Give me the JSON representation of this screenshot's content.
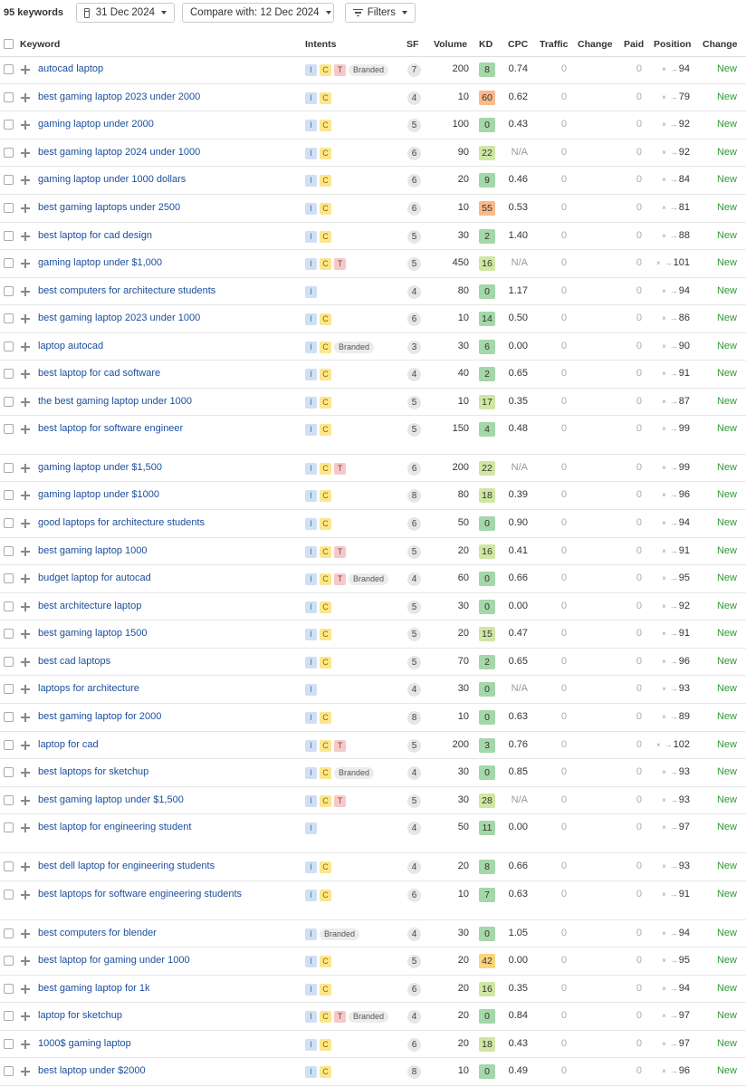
{
  "toolbar": {
    "keyword_count": "95 keywords",
    "date_label": "31 Dec 2024",
    "compare_label": "Compare with: 12 Dec 2024",
    "filters_label": "Filters"
  },
  "columns": {
    "keyword": "Keyword",
    "intents": "Intents",
    "sf": "SF",
    "volume": "Volume",
    "kd": "KD",
    "cpc": "CPC",
    "traffic": "Traffic",
    "change": "Change",
    "paid": "Paid",
    "position": "Position",
    "position_change": "Change"
  },
  "kd_colors": {
    "very_easy": "#a4d7a9",
    "easy": "#cfe7a3",
    "medium": "#fbd57a",
    "hard": "#f9b98a"
  },
  "rows": [
    {
      "keyword": "autocad laptop",
      "intents": [
        "I",
        "C",
        "T",
        "Branded"
      ],
      "sf": "7",
      "volume": "200",
      "kd": "8",
      "cpc": "0.74",
      "traffic": "0",
      "paid": "0",
      "pos_prev": "×",
      "position": "94",
      "change": "New"
    },
    {
      "keyword": "best gaming laptop 2023 under 2000",
      "intents": [
        "I",
        "C"
      ],
      "sf": "4",
      "volume": "10",
      "kd": "60",
      "cpc": "0.62",
      "traffic": "0",
      "paid": "0",
      "pos_prev": "×",
      "position": "79",
      "change": "New"
    },
    {
      "keyword": "gaming laptop under 2000",
      "intents": [
        "I",
        "C"
      ],
      "sf": "5",
      "volume": "100",
      "kd": "0",
      "cpc": "0.43",
      "traffic": "0",
      "paid": "0",
      "pos_prev": "×",
      "position": "92",
      "change": "New"
    },
    {
      "keyword": "best gaming laptop 2024 under 1000",
      "intents": [
        "I",
        "C"
      ],
      "sf": "6",
      "volume": "90",
      "kd": "22",
      "cpc": "N/A",
      "traffic": "0",
      "paid": "0",
      "pos_prev": "×",
      "position": "92",
      "change": "New"
    },
    {
      "keyword": "gaming laptop under 1000 dollars",
      "intents": [
        "I",
        "C"
      ],
      "sf": "6",
      "volume": "20",
      "kd": "9",
      "cpc": "0.46",
      "traffic": "0",
      "paid": "0",
      "pos_prev": "×",
      "position": "84",
      "change": "New"
    },
    {
      "keyword": "best gaming laptops under 2500",
      "intents": [
        "I",
        "C"
      ],
      "sf": "6",
      "volume": "10",
      "kd": "55",
      "cpc": "0.53",
      "traffic": "0",
      "paid": "0",
      "pos_prev": "×",
      "position": "81",
      "change": "New"
    },
    {
      "keyword": "best laptop for cad design",
      "intents": [
        "I",
        "C"
      ],
      "sf": "5",
      "volume": "30",
      "kd": "2",
      "cpc": "1.40",
      "traffic": "0",
      "paid": "0",
      "pos_prev": "×",
      "position": "88",
      "change": "New"
    },
    {
      "keyword": "gaming laptop under $1,000",
      "intents": [
        "I",
        "C",
        "T"
      ],
      "sf": "5",
      "volume": "450",
      "kd": "16",
      "cpc": "N/A",
      "traffic": "0",
      "paid": "0",
      "pos_prev": "×",
      "position": "101",
      "change": "New"
    },
    {
      "keyword": "best computers for architecture students",
      "intents": [
        "I"
      ],
      "sf": "4",
      "volume": "80",
      "kd": "0",
      "cpc": "1.17",
      "traffic": "0",
      "paid": "0",
      "pos_prev": "×",
      "position": "94",
      "change": "New"
    },
    {
      "keyword": "best gaming laptop 2023 under 1000",
      "intents": [
        "I",
        "C"
      ],
      "sf": "6",
      "volume": "10",
      "kd": "14",
      "cpc": "0.50",
      "traffic": "0",
      "paid": "0",
      "pos_prev": "×",
      "position": "86",
      "change": "New"
    },
    {
      "keyword": "laptop autocad",
      "intents": [
        "I",
        "C",
        "Branded"
      ],
      "sf": "3",
      "volume": "30",
      "kd": "6",
      "cpc": "0.00",
      "traffic": "0",
      "paid": "0",
      "pos_prev": "×",
      "position": "90",
      "change": "New"
    },
    {
      "keyword": "best laptop for cad software",
      "intents": [
        "I",
        "C"
      ],
      "sf": "4",
      "volume": "40",
      "kd": "2",
      "cpc": "0.65",
      "traffic": "0",
      "paid": "0",
      "pos_prev": "×",
      "position": "91",
      "change": "New"
    },
    {
      "keyword": "the best gaming laptop under 1000",
      "intents": [
        "I",
        "C"
      ],
      "sf": "5",
      "volume": "10",
      "kd": "17",
      "cpc": "0.35",
      "traffic": "0",
      "paid": "0",
      "pos_prev": "×",
      "position": "87",
      "change": "New"
    },
    {
      "keyword": "best laptop for software engineer",
      "intents": [
        "I",
        "C"
      ],
      "sf": "5",
      "volume": "150",
      "kd": "4",
      "cpc": "0.48",
      "traffic": "0",
      "paid": "0",
      "pos_prev": "×",
      "position": "99",
      "change": "New"
    },
    {
      "keyword": "gaming laptop under $1,500",
      "intents": [
        "I",
        "C",
        "T"
      ],
      "sf": "6",
      "volume": "200",
      "kd": "22",
      "cpc": "N/A",
      "traffic": "0",
      "paid": "0",
      "pos_prev": "×",
      "position": "99",
      "change": "New"
    },
    {
      "keyword": "gaming laptop under $1000",
      "intents": [
        "I",
        "C"
      ],
      "sf": "8",
      "volume": "80",
      "kd": "18",
      "cpc": "0.39",
      "traffic": "0",
      "paid": "0",
      "pos_prev": "×",
      "position": "96",
      "change": "New"
    },
    {
      "keyword": "good laptops for architecture students",
      "intents": [
        "I",
        "C"
      ],
      "sf": "6",
      "volume": "50",
      "kd": "0",
      "cpc": "0.90",
      "traffic": "0",
      "paid": "0",
      "pos_prev": "×",
      "position": "94",
      "change": "New"
    },
    {
      "keyword": "best gaming laptop 1000",
      "intents": [
        "I",
        "C",
        "T"
      ],
      "sf": "5",
      "volume": "20",
      "kd": "16",
      "cpc": "0.41",
      "traffic": "0",
      "paid": "0",
      "pos_prev": "×",
      "position": "91",
      "change": "New"
    },
    {
      "keyword": "budget laptop for autocad",
      "intents": [
        "I",
        "C",
        "T",
        "Branded"
      ],
      "sf": "4",
      "volume": "60",
      "kd": "0",
      "cpc": "0.66",
      "traffic": "0",
      "paid": "0",
      "pos_prev": "×",
      "position": "95",
      "change": "New"
    },
    {
      "keyword": "best architecture laptop",
      "intents": [
        "I",
        "C"
      ],
      "sf": "5",
      "volume": "30",
      "kd": "0",
      "cpc": "0.00",
      "traffic": "0",
      "paid": "0",
      "pos_prev": "×",
      "position": "92",
      "change": "New"
    },
    {
      "keyword": "best gaming laptop 1500",
      "intents": [
        "I",
        "C"
      ],
      "sf": "5",
      "volume": "20",
      "kd": "15",
      "cpc": "0.47",
      "traffic": "0",
      "paid": "0",
      "pos_prev": "×",
      "position": "91",
      "change": "New"
    },
    {
      "keyword": "best cad laptops",
      "intents": [
        "I",
        "C"
      ],
      "sf": "5",
      "volume": "70",
      "kd": "2",
      "cpc": "0.65",
      "traffic": "0",
      "paid": "0",
      "pos_prev": "×",
      "position": "96",
      "change": "New"
    },
    {
      "keyword": "laptops for architecture",
      "intents": [
        "I"
      ],
      "sf": "4",
      "volume": "30",
      "kd": "0",
      "cpc": "N/A",
      "traffic": "0",
      "paid": "0",
      "pos_prev": "×",
      "position": "93",
      "change": "New"
    },
    {
      "keyword": "best gaming laptop for 2000",
      "intents": [
        "I",
        "C"
      ],
      "sf": "8",
      "volume": "10",
      "kd": "0",
      "cpc": "0.63",
      "traffic": "0",
      "paid": "0",
      "pos_prev": "×",
      "position": "89",
      "change": "New"
    },
    {
      "keyword": "laptop for cad",
      "intents": [
        "I",
        "C",
        "T"
      ],
      "sf": "5",
      "volume": "200",
      "kd": "3",
      "cpc": "0.76",
      "traffic": "0",
      "paid": "0",
      "pos_prev": "×",
      "position": "102",
      "change": "New"
    },
    {
      "keyword": "best laptops for sketchup",
      "intents": [
        "I",
        "C",
        "Branded"
      ],
      "sf": "4",
      "volume": "30",
      "kd": "0",
      "cpc": "0.85",
      "traffic": "0",
      "paid": "0",
      "pos_prev": "×",
      "position": "93",
      "change": "New"
    },
    {
      "keyword": "best gaming laptop under $1,500",
      "intents": [
        "I",
        "C",
        "T"
      ],
      "sf": "5",
      "volume": "30",
      "kd": "28",
      "cpc": "N/A",
      "traffic": "0",
      "paid": "0",
      "pos_prev": "×",
      "position": "93",
      "change": "New"
    },
    {
      "keyword": "best laptop for engineering student",
      "intents": [
        "I"
      ],
      "sf": "4",
      "volume": "50",
      "kd": "11",
      "cpc": "0.00",
      "traffic": "0",
      "paid": "0",
      "pos_prev": "×",
      "position": "97",
      "change": "New"
    },
    {
      "keyword": "best dell laptop for engineering students",
      "intents": [
        "I",
        "C"
      ],
      "sf": "4",
      "volume": "20",
      "kd": "8",
      "cpc": "0.66",
      "traffic": "0",
      "paid": "0",
      "pos_prev": "×",
      "position": "93",
      "change": "New"
    },
    {
      "keyword": "best laptops for software engineering students",
      "intents": [
        "I",
        "C"
      ],
      "sf": "6",
      "volume": "10",
      "kd": "7",
      "cpc": "0.63",
      "traffic": "0",
      "paid": "0",
      "pos_prev": "×",
      "position": "91",
      "change": "New"
    },
    {
      "keyword": "best computers for blender",
      "intents": [
        "I",
        "Branded"
      ],
      "sf": "4",
      "volume": "30",
      "kd": "0",
      "cpc": "1.05",
      "traffic": "0",
      "paid": "0",
      "pos_prev": "×",
      "position": "94",
      "change": "New"
    },
    {
      "keyword": "best laptop for gaming under 1000",
      "intents": [
        "I",
        "C"
      ],
      "sf": "5",
      "volume": "20",
      "kd": "42",
      "cpc": "0.00",
      "traffic": "0",
      "paid": "0",
      "pos_prev": "×",
      "position": "95",
      "change": "New"
    },
    {
      "keyword": "best gaming laptop for 1k",
      "intents": [
        "I",
        "C"
      ],
      "sf": "6",
      "volume": "20",
      "kd": "16",
      "cpc": "0.35",
      "traffic": "0",
      "paid": "0",
      "pos_prev": "×",
      "position": "94",
      "change": "New"
    },
    {
      "keyword": "laptop for sketchup",
      "intents": [
        "I",
        "C",
        "T",
        "Branded"
      ],
      "sf": "4",
      "volume": "20",
      "kd": "0",
      "cpc": "0.84",
      "traffic": "0",
      "paid": "0",
      "pos_prev": "×",
      "position": "97",
      "change": "New"
    },
    {
      "keyword": "1000$ gaming laptop",
      "intents": [
        "I",
        "C"
      ],
      "sf": "6",
      "volume": "20",
      "kd": "18",
      "cpc": "0.43",
      "traffic": "0",
      "paid": "0",
      "pos_prev": "×",
      "position": "97",
      "change": "New"
    },
    {
      "keyword": "best laptop under $2000",
      "intents": [
        "I",
        "C"
      ],
      "sf": "8",
      "volume": "10",
      "kd": "0",
      "cpc": "0.49",
      "traffic": "0",
      "paid": "0",
      "pos_prev": "×",
      "position": "96",
      "change": "New"
    }
  ]
}
